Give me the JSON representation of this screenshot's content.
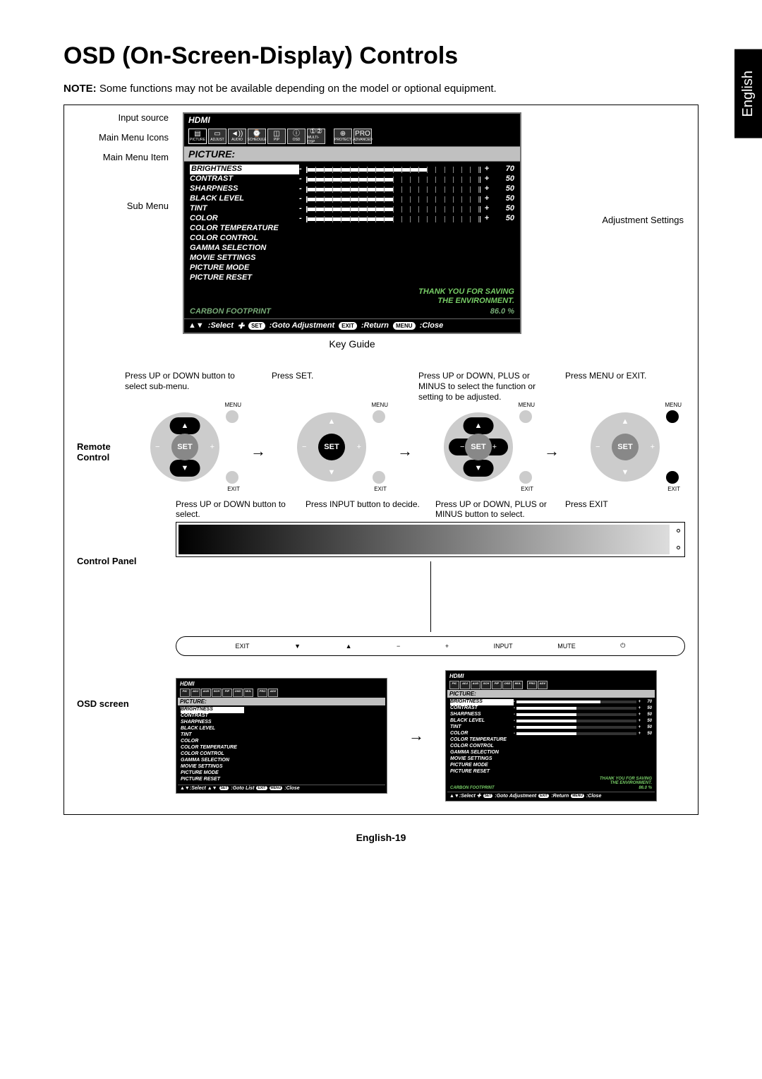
{
  "lang_tab": "English",
  "title": "OSD (On-Screen-Display) Controls",
  "note_label": "NOTE:",
  "note_text": "Some functions may not be available depending on the model or optional equipment.",
  "labels": {
    "input_source": "Input source",
    "main_menu_icons": "Main Menu Icons",
    "main_menu_item": "Main Menu Item",
    "sub_menu": "Sub Menu",
    "adjustment_settings": "Adjustment Settings",
    "key_guide": "Key Guide",
    "remote_control": "Remote Control",
    "control_panel": "Control Panel",
    "osd_screen": "OSD screen"
  },
  "osd": {
    "input": "HDMI",
    "menu_title": "PICTURE:",
    "icons": [
      "PICTURE",
      "ADJUST",
      "AUDIO",
      "SCHEDULE",
      "PIP",
      "OSD",
      "MULTI-DSP",
      "",
      "PROTECT",
      "ADVANCED"
    ],
    "icon_glyphs": [
      "▤",
      "▭",
      "◄))",
      "⌚",
      "◫",
      "ⓘ",
      "①②",
      "",
      "⊕",
      "PRO"
    ],
    "items": [
      {
        "label": "BRIGHTNESS",
        "val": 70,
        "slider": true,
        "sel": true
      },
      {
        "label": "CONTRAST",
        "val": 50,
        "slider": true
      },
      {
        "label": "SHARPNESS",
        "val": 50,
        "slider": true
      },
      {
        "label": "BLACK LEVEL",
        "val": 50,
        "slider": true
      },
      {
        "label": "TINT",
        "val": 50,
        "slider": true
      },
      {
        "label": "COLOR",
        "val": 50,
        "slider": true
      },
      {
        "label": "COLOR TEMPERATURE",
        "slider": false
      },
      {
        "label": "COLOR CONTROL",
        "slider": false
      },
      {
        "label": "GAMMA SELECTION",
        "slider": false
      },
      {
        "label": "MOVIE SETTINGS",
        "slider": false
      },
      {
        "label": "PICTURE MODE",
        "slider": false
      },
      {
        "label": "PICTURE RESET",
        "slider": false
      }
    ],
    "info_line1": "THANK YOU FOR SAVING",
    "info_line2": "THE ENVIRONMENT.",
    "carbon_label": "CARBON FOOTPRINT",
    "carbon_value": "86.0 %",
    "kg": {
      "select_symbol": "▲▼",
      "select": ":Select",
      "plus_symbol": "✚",
      "set": "SET",
      "goto_adj": ":Goto Adjustment",
      "exit": "EXIT",
      "return": ":Return",
      "menu": "MENU",
      "close": ":Close",
      "goto_list": ":Goto List"
    }
  },
  "remotes": {
    "captions": [
      "Press UP or DOWN button to select sub-menu.",
      "Press SET.",
      "Press UP or DOWN, PLUS or MINUS to select the function or setting to be adjusted.",
      "Press MENU or EXIT."
    ],
    "set": "SET",
    "menu": "MENU",
    "exit": "EXIT",
    "minus": "−",
    "plus": "+"
  },
  "panel": {
    "captions": [
      "Press UP or DOWN button to select.",
      "Press INPUT button to decide.",
      "Press UP or DOWN, PLUS or MINUS button to select.",
      "Press EXIT"
    ],
    "buttons": [
      "EXIT",
      "▼",
      "▲",
      "−",
      "+",
      "INPUT",
      "MUTE",
      "⏻"
    ]
  },
  "page_number": "English-19"
}
